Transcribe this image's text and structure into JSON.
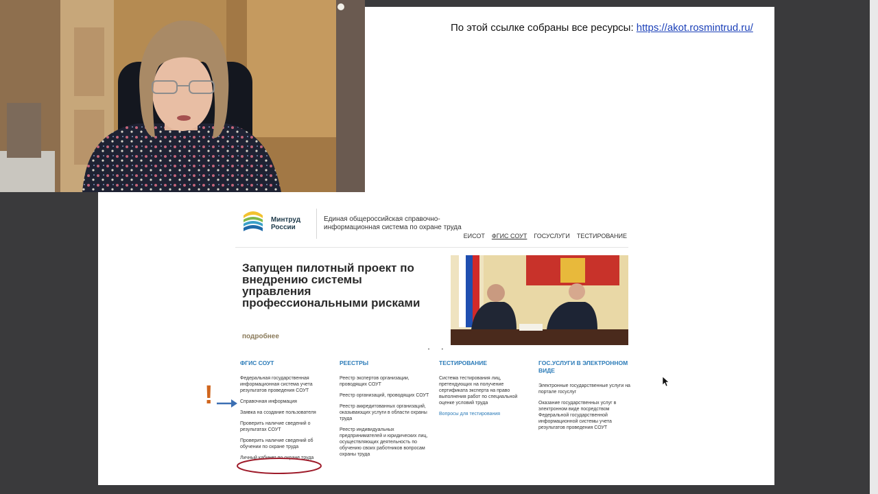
{
  "caption": {
    "text": "По этой ссылке собраны все ресурсы: ",
    "link": "https://akot.rosmintrud.ru/"
  },
  "site": {
    "logo_text": "Минтруд России",
    "system_title": "Единая общероссийская справочно-информационная система по охране труда",
    "nav": [
      "ЕИСОТ",
      "ФГИС СОУТ",
      "ГОСУСЛУГИ",
      "ТЕСТИРОВАНИЕ"
    ],
    "nav_active": "ФГИС СОУТ",
    "banner": {
      "title": "Запущен пилотный проект по внедрению системы управления профессиональными рисками",
      "more": "подробнее"
    },
    "columns": [
      {
        "heading": "ФГИС СОУТ",
        "items": [
          "Федеральная государственная информационная система учета результатов проведения СОУТ",
          "Справочная информация",
          "Заявка на создание пользователя",
          "Проверить наличие сведений о результатах СОУТ",
          "Проверить наличие сведений об обучении по охране труда",
          "Личный кабинет по охране труда"
        ]
      },
      {
        "heading": "РЕЕСТРЫ",
        "items": [
          "Реестр экспертов организации, проводящих СОУТ",
          "Реестр организаций, проводящих СОУТ",
          "Реестр аккредитованных организаций, оказывающих услуги в области охраны труда",
          "Реестр индивидуальных предпринимателей и юридических лиц, осуществляющих деятельность по обучению своих работников вопросам охраны труда"
        ]
      },
      {
        "heading": "ТЕСТИРОВАНИЕ",
        "items": [
          "Система тестирования лиц, претендующих на получение сертификата эксперта на право выполнения работ по специальной оценке условий труда",
          "Вопросы для тестирования"
        ]
      },
      {
        "heading": "ГОС.УСЛУГИ В ЭЛЕКТРОННОМ ВИДЕ",
        "items": [
          "Электронные государственные услуги на портале госуслуг",
          "Оказание государственных услуг в электронном виде посредством Федеральной государственной информационной системы учета результатов проведения СОУТ"
        ]
      }
    ]
  },
  "annotations": {
    "exclamation": "!"
  },
  "colors": {
    "link_blue": "#2b7bb8",
    "annotation_orange": "#d0661e",
    "annotation_arrow": "#3b6fb3",
    "circle_red": "#9e1b2a"
  },
  "icons": [
    "mintrud-logo-icon",
    "arrow-right-icon",
    "mouse-cursor-icon"
  ]
}
